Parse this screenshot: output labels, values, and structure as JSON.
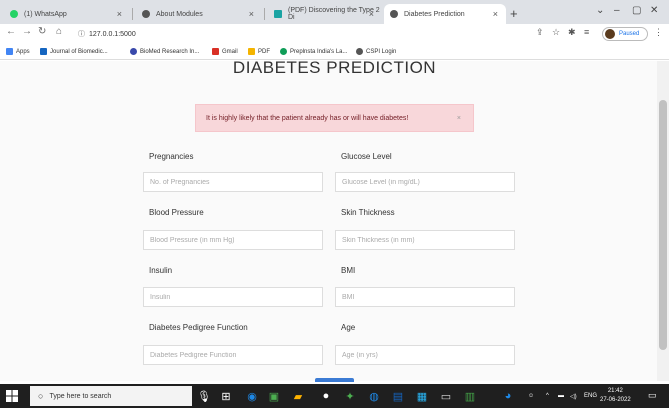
{
  "browser": {
    "tabs": [
      {
        "title": "(1) WhatsApp",
        "icon": "whatsapp-icon",
        "color": "#25d366"
      },
      {
        "title": "About Modules",
        "icon": "globe-icon",
        "color": "#555555"
      },
      {
        "title": "(PDF) Discovering the Type 2 Di",
        "icon": "researchgate-icon",
        "color": "#1aa3a3"
      },
      {
        "title": "Diabetes Prediction",
        "icon": "globe-icon",
        "color": "#555555"
      }
    ],
    "close_glyph": "×",
    "new_tab_glyph": "+",
    "url": "127.0.0.1:5000",
    "paused_label": "Paused",
    "bookmarks": [
      {
        "label": "Apps",
        "color": "#4285f4"
      },
      {
        "label": "Journal of Biomedic...",
        "color": "#1565c0"
      },
      {
        "label": "BioMed Research In...",
        "color": "#3949ab"
      },
      {
        "label": "Gmail",
        "color": "#d93025"
      },
      {
        "label": "PDF",
        "color": "#f4b400"
      },
      {
        "label": "Preplnsta India's La...",
        "color": "#0f9d58"
      },
      {
        "label": "CSPI Login",
        "color": "#555555"
      }
    ]
  },
  "page": {
    "title": "DIABETES PREDICTION",
    "alert_text": "It is highly likely that the patient already has or will have diabetes!",
    "alert_close": "×",
    "fields": {
      "pregnancies": {
        "label": "Pregnancies",
        "placeholder": "No. of Pregnancies"
      },
      "glucose": {
        "label": "Glucose Level",
        "placeholder": "Glucose Level (in mg/dL)"
      },
      "blood_pressure": {
        "label": "Blood Pressure",
        "placeholder": "Blood Pressure (in mm Hg)"
      },
      "skin_thickness": {
        "label": "Skin Thickness",
        "placeholder": "Skin Thickness (in mm)"
      },
      "insulin": {
        "label": "Insulin",
        "placeholder": "Insulin"
      },
      "bmi": {
        "label": "BMI",
        "placeholder": "BMI"
      },
      "dpf": {
        "label": "Diabetes Pedigree Function",
        "placeholder": "Diabetes Pedigree Function"
      },
      "age": {
        "label": "Age",
        "placeholder": "Age (in yrs)"
      }
    }
  },
  "taskbar": {
    "search_placeholder": "Type here to search",
    "tray_lang": "ENG",
    "time": "21:42",
    "date": "27-06-2022"
  },
  "colors": {
    "alert_bg": "#f8d7da",
    "alert_text": "#721c24",
    "accent": "#3b7bd4"
  }
}
